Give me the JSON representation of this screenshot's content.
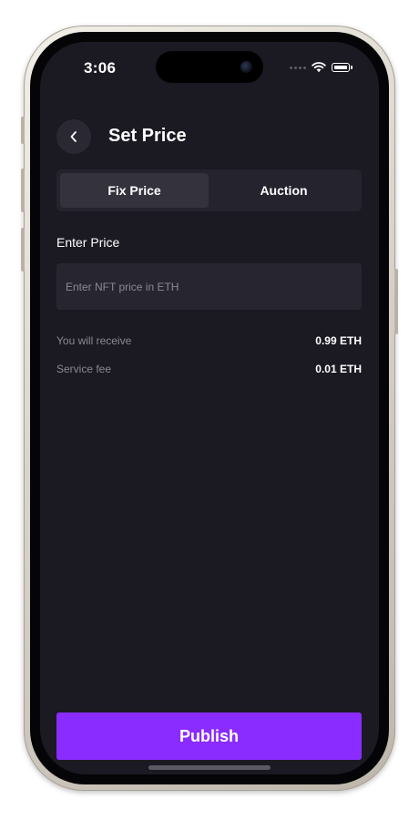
{
  "status_bar": {
    "time": "3:06"
  },
  "header": {
    "title": "Set Price",
    "back_icon": "chevron-left-icon"
  },
  "tabs": [
    {
      "label": "Fix Price",
      "active": true
    },
    {
      "label": "Auction",
      "active": false
    }
  ],
  "price_field": {
    "label": "Enter Price",
    "placeholder": "Enter NFT price in ETH",
    "value": ""
  },
  "summary": [
    {
      "label": "You will receive",
      "value": "0.99 ETH"
    },
    {
      "label": "Service fee",
      "value": "0.01 ETH"
    }
  ],
  "publish_button": {
    "label": "Publish"
  },
  "colors": {
    "background": "#1b1a23",
    "accent": "#8a2cff",
    "surface": "#272630"
  }
}
